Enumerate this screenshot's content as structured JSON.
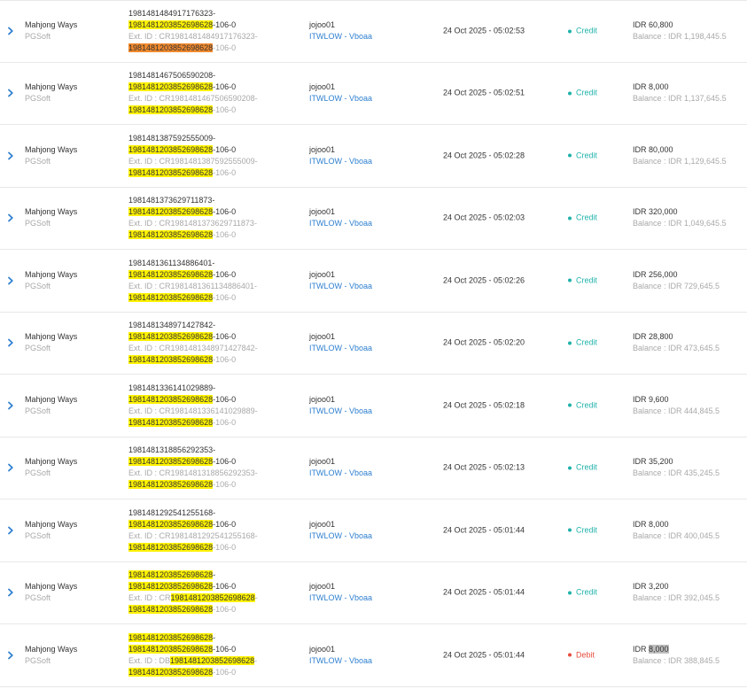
{
  "colors": {
    "credit": "#20b2aa",
    "debit": "#e74c3c",
    "link": "#2f80d0",
    "highlight": "#fff200",
    "highlight_current": "#f08a2e",
    "muted": "#a9a9a9"
  },
  "icons": {
    "expand": "chevron-right-icon"
  },
  "rows": [
    {
      "game": "Mahjong Ways",
      "provider": "PGSoft",
      "txn_prefix": "1981481484917176323-",
      "txn_match": "1981481203852698628",
      "txn_suffix": "-106-0",
      "ext_prefix": "Ext. ID : CR1981481484917176323-",
      "ext_match": "1981481203852698628",
      "ext_suffix": "-106-0",
      "user": "jojoo01",
      "agent": "ITWLOW - Vboaa",
      "date": "24 Oct 2025 - 05:02:53",
      "type": "Credit",
      "amount": "IDR 60,800",
      "balance": "Balance : IDR 1,198,445.5"
    },
    {
      "game": "Mahjong Ways",
      "provider": "PGSoft",
      "txn_prefix": "1981481467506590208-",
      "txn_match": "1981481203852698628",
      "txn_suffix": "-106-0",
      "ext_prefix": "Ext. ID : CR1981481467506590208-",
      "ext_match": "1981481203852698628",
      "ext_suffix": "-106-0",
      "user": "jojoo01",
      "agent": "ITWLOW - Vboaa",
      "date": "24 Oct 2025 - 05:02:51",
      "type": "Credit",
      "amount": "IDR 8,000",
      "balance": "Balance : IDR 1,137,645.5"
    },
    {
      "game": "Mahjong Ways",
      "provider": "PGSoft",
      "txn_prefix": "1981481387592555009-",
      "txn_match": "1981481203852698628",
      "txn_suffix": "-106-0",
      "ext_prefix": "Ext. ID : CR1981481387592555009-",
      "ext_match": "1981481203852698628",
      "ext_suffix": "-106-0",
      "user": "jojoo01",
      "agent": "ITWLOW - Vboaa",
      "date": "24 Oct 2025 - 05:02:28",
      "type": "Credit",
      "amount": "IDR 80,000",
      "balance": "Balance : IDR 1,129,645.5"
    },
    {
      "game": "Mahjong Ways",
      "provider": "PGSoft",
      "txn_prefix": "1981481373629711873-",
      "txn_match": "1981481203852698628",
      "txn_suffix": "-106-0",
      "ext_prefix": "Ext. ID : CR1981481373629711873-",
      "ext_match": "1981481203852698628",
      "ext_suffix": "-106-0",
      "user": "jojoo01",
      "agent": "ITWLOW - Vboaa",
      "date": "24 Oct 2025 - 05:02:03",
      "type": "Credit",
      "amount": "IDR 320,000",
      "balance": "Balance : IDR 1,049,645.5"
    },
    {
      "game": "Mahjong Ways",
      "provider": "PGSoft",
      "txn_prefix": "1981481361134886401-",
      "txn_match": "1981481203852698628",
      "txn_suffix": "-106-0",
      "ext_prefix": "Ext. ID : CR1981481361134886401-",
      "ext_match": "1981481203852698628",
      "ext_suffix": "-106-0",
      "user": "jojoo01",
      "agent": "ITWLOW - Vboaa",
      "date": "24 Oct 2025 - 05:02:26",
      "type": "Credit",
      "amount": "IDR 256,000",
      "balance": "Balance : IDR 729,645.5"
    },
    {
      "game": "Mahjong Ways",
      "provider": "PGSoft",
      "txn_prefix": "1981481348971427842-",
      "txn_match": "1981481203852698628",
      "txn_suffix": "-106-0",
      "ext_prefix": "Ext. ID : CR1981481348971427842-",
      "ext_match": "1981481203852698628",
      "ext_suffix": "-106-0",
      "user": "jojoo01",
      "agent": "ITWLOW - Vboaa",
      "date": "24 Oct 2025 - 05:02:20",
      "type": "Credit",
      "amount": "IDR 28,800",
      "balance": "Balance : IDR 473,645.5"
    },
    {
      "game": "Mahjong Ways",
      "provider": "PGSoft",
      "txn_prefix": "1981481336141029889-",
      "txn_match": "1981481203852698628",
      "txn_suffix": "-106-0",
      "ext_prefix": "Ext. ID : CR1981481336141029889-",
      "ext_match": "1981481203852698628",
      "ext_suffix": "-106-0",
      "user": "jojoo01",
      "agent": "ITWLOW - Vboaa",
      "date": "24 Oct 2025 - 05:02:18",
      "type": "Credit",
      "amount": "IDR 9,600",
      "balance": "Balance : IDR 444,845.5"
    },
    {
      "game": "Mahjong Ways",
      "provider": "PGSoft",
      "txn_prefix": "1981481318856292353-",
      "txn_match": "1981481203852698628",
      "txn_suffix": "-106-0",
      "ext_prefix": "Ext. ID : CR1981481318856292353-",
      "ext_match": "1981481203852698628",
      "ext_suffix": "-106-0",
      "user": "jojoo01",
      "agent": "ITWLOW - Vboaa",
      "date": "24 Oct 2025 - 05:02:13",
      "type": "Credit",
      "amount": "IDR 35,200",
      "balance": "Balance : IDR 435,245.5"
    },
    {
      "game": "Mahjong Ways",
      "provider": "PGSoft",
      "txn_prefix": "1981481292541255168-",
      "txn_match": "1981481203852698628",
      "txn_suffix": "-106-0",
      "ext_prefix": "Ext. ID : CR1981481292541255168-",
      "ext_match": "1981481203852698628",
      "ext_suffix": "-106-0",
      "user": "jojoo01",
      "agent": "ITWLOW - Vboaa",
      "date": "24 Oct 2025 - 05:01:44",
      "type": "Credit",
      "amount": "IDR 8,000",
      "balance": "Balance : IDR 400,045.5"
    },
    {
      "game": "Mahjong Ways",
      "provider": "PGSoft",
      "txn_prefix": "",
      "txn_match": "1981481203852698628",
      "txn_suffix": "-",
      "ext_prefix": "Ext. ID : CR",
      "ext_match": "1981481203852698628",
      "ext_suffix": "-",
      "user": "jojoo01",
      "agent": "ITWLOW - Vboaa",
      "date": "24 Oct 2025 - 05:01:44",
      "type": "Credit",
      "amount": "IDR 3,200",
      "balance": "Balance : IDR 392,045.5"
    },
    {
      "game": "Mahjong Ways",
      "provider": "PGSoft",
      "txn_prefix": "",
      "txn_match": "1981481203852698628",
      "txn_suffix": "-",
      "ext_prefix": "Ext. ID : DB",
      "ext_match": "1981481203852698628",
      "ext_suffix": "-",
      "user": "jojoo01",
      "agent": "ITWLOW - Vboaa",
      "date": "24 Oct 2025 - 05:01:44",
      "type": "Debit",
      "amount": "IDR 8,000",
      "balance": "Balance : IDR 388,845.5"
    }
  ],
  "line_tail": "-106-0"
}
